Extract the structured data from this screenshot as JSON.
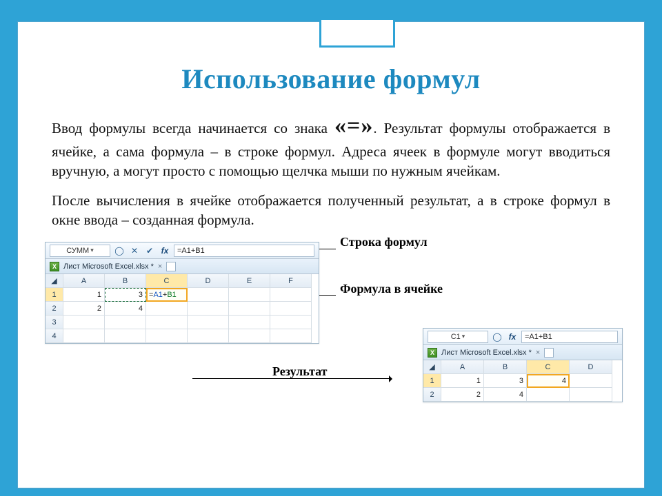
{
  "title": "Использование формул",
  "para1_a": "Ввод формулы всегда начинается со знака ",
  "eq_sign": "«=»",
  "para1_b": ". Результат формулы отображается в ячейке, а сама формула – в строке формул. Адреса ячеек в формуле могут вводиться вручную, а могут просто с помощью щелчка мыши по нужным ячейкам.",
  "para2": "После вычисления в ячейке отображается полученный результат, а в строке формул в окне ввода – созданная формула.",
  "labels": {
    "formula_bar": "Строка формул",
    "cell_formula": "Формула в ячейке",
    "result": "Результат"
  },
  "xl1": {
    "namebox": "СУММ",
    "formula_input": "=A1+B1",
    "tab_title": "Лист Microsoft Excel.xlsx *",
    "cols": [
      "A",
      "B",
      "C",
      "D",
      "E",
      "F"
    ],
    "rows": [
      "1",
      "2",
      "3",
      "4"
    ],
    "cell_formula_eq": "=",
    "cell_formula_a1": "A1",
    "cell_formula_plus": "+",
    "cell_formula_b1": "B1",
    "a1": "1",
    "b1": "3",
    "a2": "2",
    "b2": "4"
  },
  "xl2": {
    "namebox": "C1",
    "formula_input": "=A1+B1",
    "tab_title": "Лист Microsoft Excel.xlsx *",
    "cols": [
      "A",
      "B",
      "C",
      "D"
    ],
    "rows": [
      "1",
      "2"
    ],
    "a1": "1",
    "b1": "3",
    "c1": "4",
    "a2": "2",
    "b2": "4"
  }
}
